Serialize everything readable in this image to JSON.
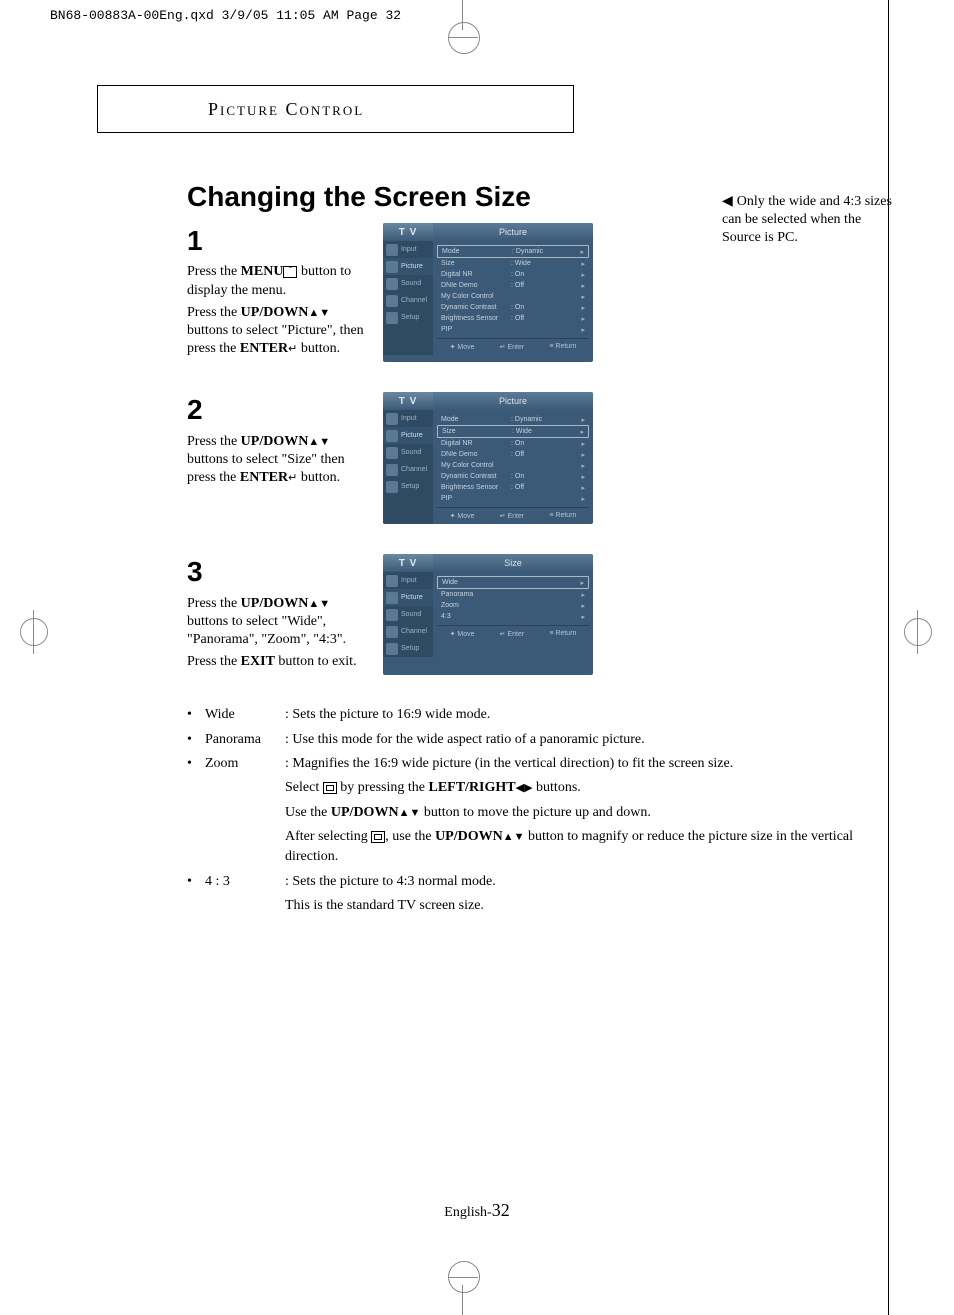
{
  "print_header": "BN68-00883A-00Eng.qxd  3/9/05 11:05 AM  Page 32",
  "section_header": "Picture Control",
  "title": "Changing the Screen Size",
  "side_note": "Only the wide and 4:3 sizes can be selected when the Source is PC.",
  "steps": [
    {
      "num": "1",
      "paragraphs": [
        {
          "runs": [
            {
              "t": "Press the "
            },
            {
              "t": "MENU",
              "b": true
            },
            {
              "icon": "menu"
            },
            {
              "t": "  button to display the menu."
            }
          ]
        },
        {
          "runs": [
            {
              "t": "Press the "
            },
            {
              "t": "UP/DOWN",
              "b": true
            },
            {
              "icon": "ud"
            },
            {
              "t": " buttons to select \"Picture\", then press the "
            },
            {
              "t": "ENTER",
              "b": true
            },
            {
              "icon": "enter"
            },
            {
              "t": " button."
            }
          ]
        }
      ],
      "osd": {
        "tv": "T V",
        "title": "Picture",
        "side": [
          "Input",
          "Picture",
          "Sound",
          "Channel",
          "Setup"
        ],
        "side_active": 1,
        "highlighted": 0,
        "rows": [
          {
            "l": "Mode",
            "v": ": Dynamic"
          },
          {
            "l": "Size",
            "v": ": Wide"
          },
          {
            "l": "Digital NR",
            "v": ": On"
          },
          {
            "l": "DNIe Demo",
            "v": ": Off"
          },
          {
            "l": "My Color Control",
            "v": ""
          },
          {
            "l": "Dynamic Contrast",
            "v": ": On"
          },
          {
            "l": "Brightness Sensor",
            "v": ": Off"
          },
          {
            "l": "PIP",
            "v": ""
          }
        ],
        "footer": [
          "Move",
          "Enter",
          "Return"
        ]
      }
    },
    {
      "num": "2",
      "paragraphs": [
        {
          "runs": [
            {
              "t": "Press the "
            },
            {
              "t": "UP/DOWN",
              "b": true
            },
            {
              "icon": "ud"
            },
            {
              "t": " buttons to select \"Size\" then press the "
            },
            {
              "t": "ENTER",
              "b": true
            },
            {
              "icon": "enter"
            },
            {
              "t": " button."
            }
          ]
        }
      ],
      "osd": {
        "tv": "T V",
        "title": "Picture",
        "side": [
          "Input",
          "Picture",
          "Sound",
          "Channel",
          "Setup"
        ],
        "side_active": 1,
        "highlighted": 1,
        "rows": [
          {
            "l": "Mode",
            "v": ": Dynamic"
          },
          {
            "l": "Size",
            "v": ": Wide"
          },
          {
            "l": "Digital NR",
            "v": ": On"
          },
          {
            "l": "DNIe Demo",
            "v": ": Off"
          },
          {
            "l": "My Color Control",
            "v": ""
          },
          {
            "l": "Dynamic Contrast",
            "v": ": On"
          },
          {
            "l": "Brightness Sensor",
            "v": ": Off"
          },
          {
            "l": "PIP",
            "v": ""
          }
        ],
        "footer": [
          "Move",
          "Enter",
          "Return"
        ]
      }
    },
    {
      "num": "3",
      "paragraphs": [
        {
          "runs": [
            {
              "t": "Press the "
            },
            {
              "t": "UP/DOWN",
              "b": true
            },
            {
              "icon": "ud"
            },
            {
              "t": " buttons to select \"Wide\", \"Panorama\", \"Zoom\", \"4:3\"."
            }
          ]
        },
        {
          "runs": [
            {
              "t": "Press the "
            },
            {
              "t": "EXIT",
              "b": true
            },
            {
              "t": " button to exit."
            }
          ]
        }
      ],
      "osd": {
        "tv": "T V",
        "title": "Size",
        "side": [
          "Input",
          "Picture",
          "Sound",
          "Channel",
          "Setup"
        ],
        "side_active": 1,
        "highlighted": 0,
        "rows": [
          {
            "l": "Wide",
            "v": ""
          },
          {
            "l": "Panorama",
            "v": ""
          },
          {
            "l": "Zoom",
            "v": ""
          },
          {
            "l": "4:3",
            "v": ""
          }
        ],
        "footer": [
          "Move",
          "Enter",
          "Return"
        ]
      }
    }
  ],
  "definitions": [
    {
      "term": "Wide",
      "lines": [
        [
          {
            "t": "Sets the picture to 16:9 wide mode."
          }
        ]
      ]
    },
    {
      "term": "Panorama",
      "lines": [
        [
          {
            "t": "Use this mode for the wide aspect ratio of a panoramic picture."
          }
        ]
      ]
    },
    {
      "term": "Zoom",
      "lines": [
        [
          {
            "t": "Magnifies the 16:9 wide picture (in the vertical direction) to fit the screen size."
          }
        ],
        [
          {
            "t": "Select "
          },
          {
            "icon": "pic"
          },
          {
            "t": " by pressing the "
          },
          {
            "t": "LEFT/RIGHT",
            "b": true
          },
          {
            "icon": "lr"
          },
          {
            "t": " buttons."
          }
        ],
        [
          {
            "t": "Use the "
          },
          {
            "t": "UP/DOWN",
            "b": true
          },
          {
            "icon": "ud"
          },
          {
            "t": " button to move the picture up and down."
          }
        ],
        [
          {
            "t": "After selecting "
          },
          {
            "icon": "pic"
          },
          {
            "t": ", use the "
          },
          {
            "t": "UP/DOWN",
            "b": true
          },
          {
            "icon": "ud"
          },
          {
            "t": " button to magnify or reduce the picture size in the vertical direction."
          }
        ]
      ]
    },
    {
      "term": "4 : 3",
      "lines": [
        [
          {
            "t": "Sets the picture to 4:3 normal mode."
          }
        ],
        [
          {
            "t": "This is the standard TV screen size."
          }
        ]
      ]
    }
  ],
  "footer": {
    "lang": "English-",
    "num": "32"
  }
}
